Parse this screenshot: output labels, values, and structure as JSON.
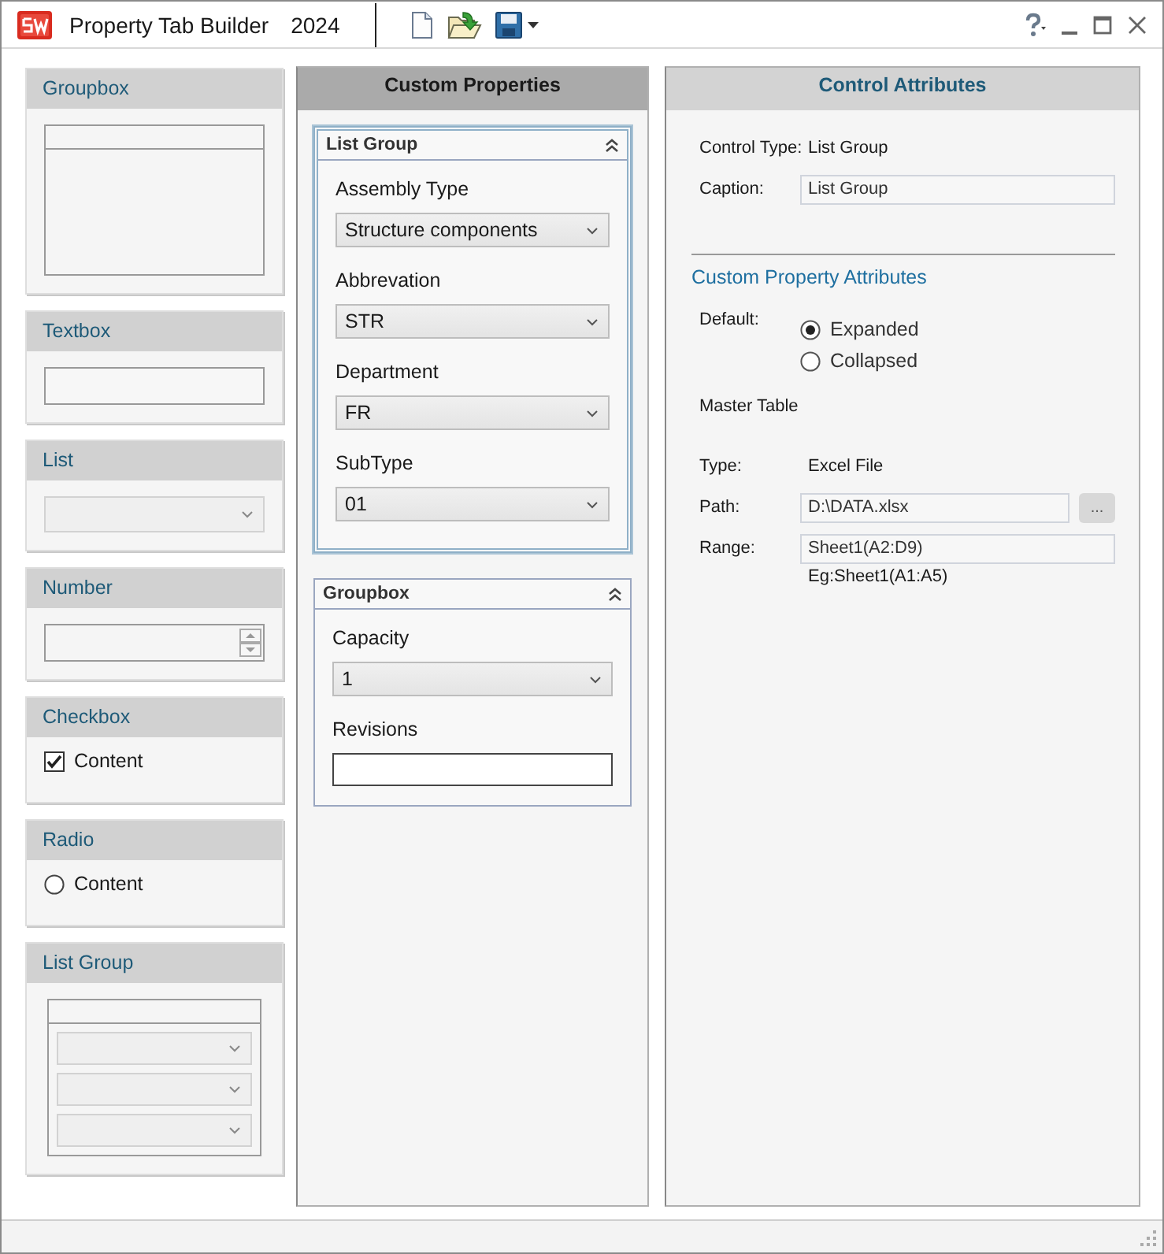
{
  "window": {
    "title": "Property Tab Builder",
    "version": "2024"
  },
  "palette": [
    {
      "kind": "groupbox",
      "title": "Groupbox"
    },
    {
      "kind": "textbox",
      "title": "Textbox"
    },
    {
      "kind": "list",
      "title": "List"
    },
    {
      "kind": "number",
      "title": "Number"
    },
    {
      "kind": "checkbox",
      "title": "Checkbox",
      "label": "Content",
      "checked": true
    },
    {
      "kind": "radio",
      "title": "Radio",
      "label": "Content",
      "selected": false
    },
    {
      "kind": "listgroup",
      "title": "List Group"
    }
  ],
  "custom_properties": {
    "title": "Custom Properties",
    "groups": [
      {
        "title": "List Group",
        "selected": true,
        "fields": [
          {
            "kind": "dropdown",
            "label": "Assembly Type",
            "value": "Structure components"
          },
          {
            "kind": "dropdown",
            "label": "Abbrevation",
            "value": "STR"
          },
          {
            "kind": "dropdown",
            "label": "Department",
            "value": "FR"
          },
          {
            "kind": "dropdown",
            "label": "SubType",
            "value": "01"
          }
        ]
      },
      {
        "title": "Groupbox",
        "selected": false,
        "fields": [
          {
            "kind": "dropdown",
            "label": "Capacity",
            "value": "1"
          },
          {
            "kind": "text",
            "label": "Revisions"
          }
        ]
      }
    ]
  },
  "control_attributes": {
    "title": "Control Attributes",
    "control_type": {
      "label": "Control Type:",
      "value": "List Group"
    },
    "caption": {
      "label": "Caption:",
      "value": "List Group"
    },
    "section_title": "Custom Property Attributes",
    "default": {
      "label": "Default:",
      "options": [
        {
          "label": "Expanded",
          "selected": true
        },
        {
          "label": "Collapsed",
          "selected": false
        }
      ]
    },
    "master_table": "Master Table",
    "type": {
      "label": "Type:",
      "value": "Excel File"
    },
    "path": {
      "label": "Path:",
      "value": "D:\\DATA.xlsx",
      "button": "..."
    },
    "range": {
      "label": "Range:",
      "value": "Sheet1(A2:D9)",
      "hint": "Eg:Sheet1(A1:A5)"
    }
  }
}
